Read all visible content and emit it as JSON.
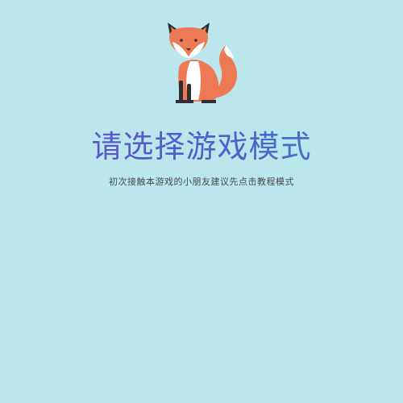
{
  "header": {
    "mascot_icon": "fox-mascot-icon",
    "title": "请选择游戏模式",
    "subtitle": "初次接触本游戏的小朋友建议先点击教程模式"
  },
  "colors": {
    "background": "#bae6ec",
    "title_gradient_start": "#6a4fc4",
    "title_gradient_end": "#3f7ad0",
    "fox_orange": "#ee7a55",
    "fox_dark": "#2f2f33",
    "fox_white": "#ffffff"
  }
}
